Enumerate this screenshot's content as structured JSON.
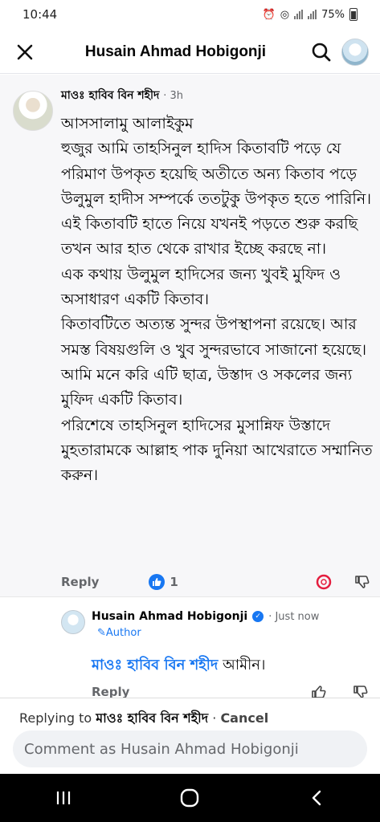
{
  "status_bar": {
    "time": "10:44",
    "battery": "75%"
  },
  "header": {
    "title": "Husain Ahmad Hobigonji"
  },
  "comment": {
    "author": "মাওঃ হাবিব বিন শহীদ",
    "time": "· 3h",
    "body": "আসসালামু আলাইকুম\nহুজুর আমি তাহসিনুল হাদিস কিতাবটি পড়ে যে পরিমাণ উপকৃত হয়েছি অতীতে অন্য কিতাব পড়ে উলুমুল হাদীস সম্পর্কে ততটুকু উপকৃত হতে পারিনি।\nএই কিতাবটি হাতে নিয়ে যখনই পড়তে শুরু করছি তখন আর হাত থেকে রাখার ইচ্ছে করছে না।\nএক কথায় উলুমুল হাদিসের জন্য খুবই মুফিদ ও অসাধারণ একটি কিতাব।\nকিতাবটিতে অত্যন্ত সুন্দর উপস্থাপনা রয়েছে। আর সমস্ত বিষয়গুলি ও খুব সুন্দরভাবে সাজানো হয়েছে।\nআমি মনে করি এটি ছাত্র, উস্তাদ ও সকলের জন্য মুফিদ একটি কিতাব।\nপরিশেষে তাহসিনুল হাদিসের মুসান্নিফ উস্তাদে মুহতারামকে আল্লাহ পাক দুনিয়া আখেরাতে সম্মানিত করুন।",
    "reply_label": "Reply",
    "like_count": "1"
  },
  "reply": {
    "author": "Husain Ahmad Hobigonji",
    "time": "· Just now",
    "author_badge": "Author",
    "mention": "মাওঃ হাবিব বিন শহীদ",
    "text": " আমীন।",
    "reply_label": "Reply"
  },
  "composer": {
    "replying_prefix": "Replying to ",
    "replying_name": "মাওঃ হাবিব বিন শহীদ",
    "separator": " · ",
    "cancel_label": "Cancel",
    "placeholder": "Comment as Husain Ahmad Hobigonji"
  },
  "colors": {
    "accent": "#1877f2",
    "reaction_red": "#e41e3f"
  },
  "icons": [
    "close-icon",
    "search-icon",
    "like-icon",
    "love-icon",
    "dislike-icon",
    "thumbs-up-icon",
    "verified-icon",
    "pencil-icon",
    "recent-apps-icon",
    "home-icon",
    "back-icon"
  ]
}
